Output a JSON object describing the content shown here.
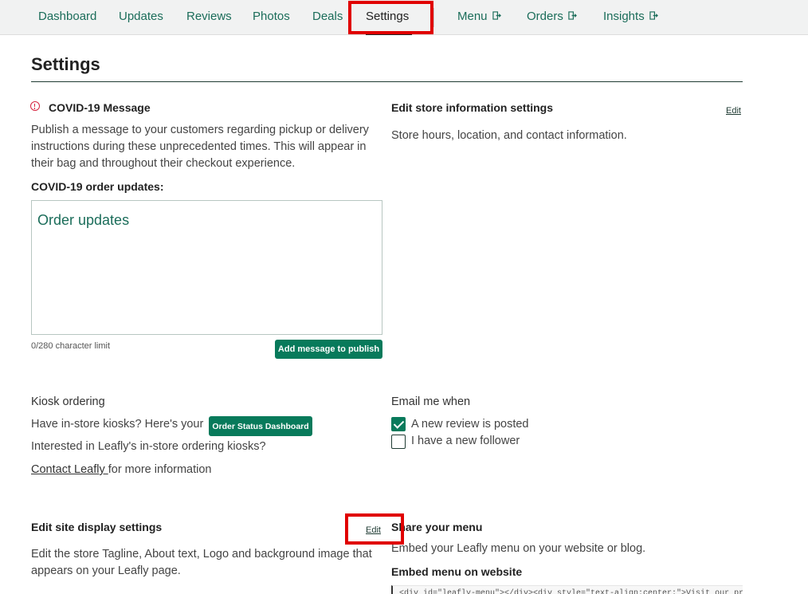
{
  "nav": {
    "items": [
      {
        "label": "Dashboard"
      },
      {
        "label": "Updates"
      },
      {
        "label": "Reviews"
      },
      {
        "label": "Photos"
      },
      {
        "label": "Deals"
      },
      {
        "label": "Settings",
        "active": true
      },
      {
        "label": "Menu",
        "external": true
      },
      {
        "label": "Orders",
        "external": true
      },
      {
        "label": "Insights",
        "external": true
      }
    ]
  },
  "page": {
    "title": "Settings"
  },
  "covid": {
    "title": "COVID-19 Message",
    "description": "Publish a message to your customers regarding pickup or delivery instructions during these unprecedented times. This will appear in their bag and throughout their checkout experience.",
    "field_label": "COVID-19 order updates:",
    "placeholder": "Order updates",
    "char_limit": "0/280 character limit",
    "button": "Add message to publish"
  },
  "store_info": {
    "title": "Edit store information settings",
    "edit": "Edit",
    "description": "Store hours, location, and contact information."
  },
  "kiosk": {
    "title": "Kiosk ordering",
    "line1": "Have in-store kiosks? Here's your",
    "button": "Order Status Dashboard",
    "line2": "Interested in Leafly's in-store ordering kiosks?",
    "contact_link": "Contact Leafly ",
    "contact_rest": "for more information"
  },
  "email": {
    "title": "Email me when",
    "options": [
      {
        "label": "A new review is posted",
        "checked": true
      },
      {
        "label": "I have a new follower",
        "checked": false
      }
    ]
  },
  "site_display": {
    "title": "Edit site display settings",
    "edit": "Edit",
    "description": "Edit the store Tagline, About text, Logo and background image that appears on your Leafly page."
  },
  "share_menu": {
    "title": "Share your menu",
    "description": "Embed your Leafly menu on your website or blog.",
    "embed_title": "Embed menu on website",
    "embed_code": "<div id=\"leafly-menu\"></div><div style=\"text-align:center;\">Visit our profile on <a"
  },
  "colors": {
    "accent": "#087a5b",
    "link": "#1b6d5a",
    "highlight": "#e00000"
  }
}
